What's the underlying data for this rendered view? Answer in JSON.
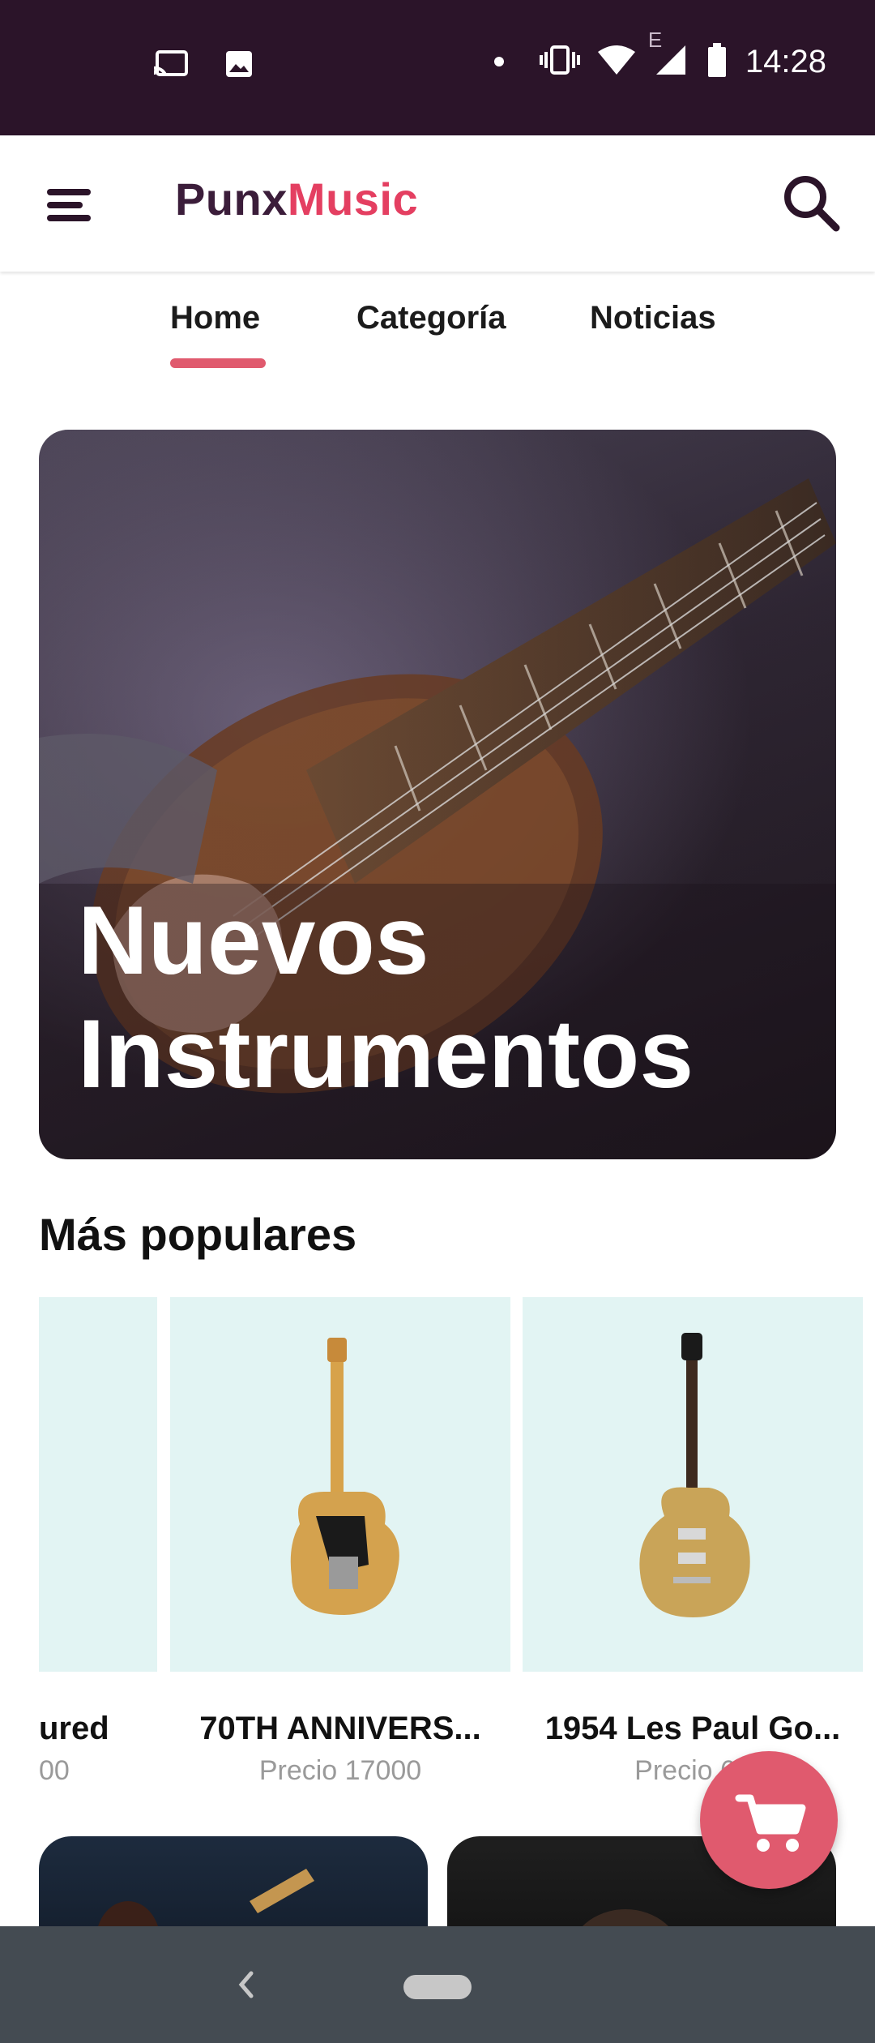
{
  "status_bar": {
    "time": "14:28",
    "network_label": "E"
  },
  "app_bar": {
    "brand_part1": "Punx",
    "brand_part2": "Music"
  },
  "tabs": [
    {
      "label": "Home",
      "selected": true
    },
    {
      "label": "Categoría",
      "selected": false
    },
    {
      "label": "Noticias",
      "selected": false
    }
  ],
  "hero": {
    "title_line1": "Nuevos",
    "title_line2": "Instrumentos"
  },
  "section": {
    "title": "Más populares"
  },
  "products": [
    {
      "name_partial": "ured",
      "price_partial": "00"
    },
    {
      "name": "70TH ANNIVERS...",
      "price": "Precio 17000"
    },
    {
      "name": "1954 Les Paul Go...",
      "price": "Precio 60"
    }
  ],
  "colors": {
    "status_bar_bg": "#2b1429",
    "brand_dark": "#3b1d3a",
    "brand_accent": "#e43f61",
    "tab_indicator": "#e05a6e",
    "product_bg": "#e2f4f3",
    "fab": "#e05a6e",
    "navbar": "#444b52"
  },
  "icons": {
    "cast": "cast-icon",
    "image": "image-icon",
    "vibrate": "vibrate-icon",
    "wifi": "wifi-icon",
    "signal": "signal-icon",
    "battery": "battery-icon",
    "menu": "menu-icon",
    "search": "search-icon",
    "cart": "cart-icon",
    "back": "back-icon",
    "home": "home-pill-icon"
  }
}
